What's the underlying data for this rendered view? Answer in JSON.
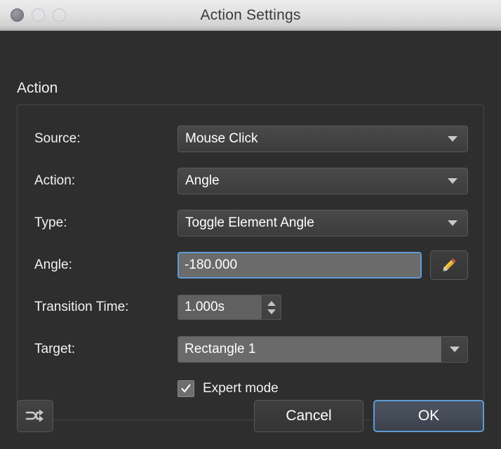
{
  "window": {
    "title": "Action Settings",
    "controls": {
      "close": "close-button",
      "minimize": "minimize-button",
      "maximize": "maximize-button"
    }
  },
  "section": {
    "title": "Action"
  },
  "fields": {
    "source": {
      "label": "Source:",
      "value": "Mouse Click"
    },
    "action": {
      "label": "Action:",
      "value": "Angle"
    },
    "type": {
      "label": "Type:",
      "value": "Toggle Element Angle"
    },
    "angle": {
      "label": "Angle:",
      "value": "-180.000",
      "edit_icon": "pencil-icon"
    },
    "transition_time": {
      "label": "Transition Time:",
      "value": "1.000s"
    },
    "target": {
      "label": "Target:",
      "value": "Rectangle 1"
    },
    "expert_mode": {
      "label": "Expert mode",
      "checked": true,
      "check_glyph": "✓"
    }
  },
  "footer": {
    "shuffle_icon": "shuffle-arrows-icon",
    "cancel_label": "Cancel",
    "ok_label": "OK"
  },
  "colors": {
    "window_bg": "#2e2e2e",
    "titlebar_bg": "#e2e2e2",
    "focus_blue": "#5e9bd6",
    "text": "#f2f2f2",
    "pencil_yellow": "#f2c94c"
  }
}
